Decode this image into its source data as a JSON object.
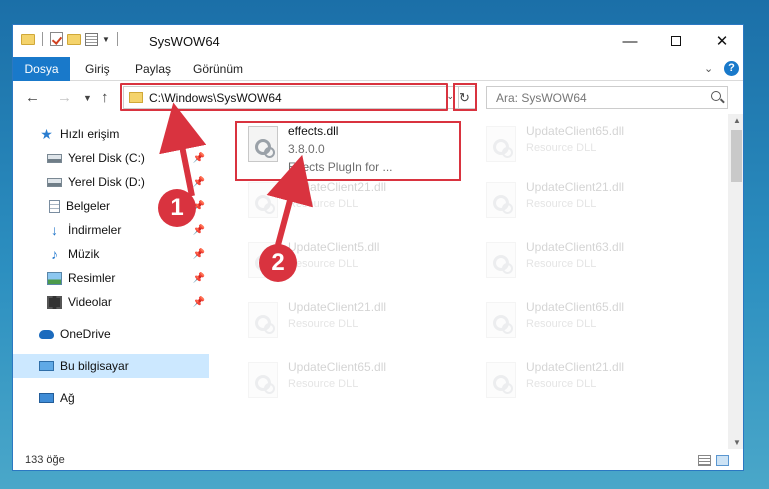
{
  "window": {
    "title": "SysWOW64",
    "minimize_label": "—",
    "maximize_label": "",
    "close_label": "✕"
  },
  "ribbon": {
    "tabs": [
      "Dosya",
      "Giriş",
      "Paylaş",
      "Görünüm"
    ],
    "expand_icon": "chevron-down-icon",
    "help_label": "?"
  },
  "address_bar": {
    "path": "C:\\Windows\\SysWOW64",
    "refresh_icon": "refresh-icon"
  },
  "search": {
    "placeholder": "Ara: SysWOW64"
  },
  "sidebar": {
    "items": [
      {
        "label": "Hızlı erişim",
        "icon": "star-icon"
      },
      {
        "label": "Yerel Disk (C:)",
        "icon": "drive-icon",
        "pinned": true
      },
      {
        "label": "Yerel Disk (D:)",
        "icon": "drive-icon",
        "pinned": true
      },
      {
        "label": "Belgeler",
        "icon": "documents-icon",
        "pinned": true
      },
      {
        "label": "İndirmeler",
        "icon": "downloads-icon",
        "pinned": true
      },
      {
        "label": "Müzik",
        "icon": "music-icon",
        "pinned": true
      },
      {
        "label": "Resimler",
        "icon": "pictures-icon",
        "pinned": true
      },
      {
        "label": "Videolar",
        "icon": "videos-icon",
        "pinned": true
      },
      {
        "label": "OneDrive",
        "icon": "onedrive-icon"
      },
      {
        "label": "Bu bilgisayar",
        "icon": "computer-icon",
        "selected": true
      },
      {
        "label": "Ağ",
        "icon": "network-icon"
      }
    ]
  },
  "files": {
    "highlighted": {
      "name": "effects.dll",
      "version": "3.8.0.0",
      "description": "Effects PlugIn for ..."
    },
    "faded": [
      {
        "name": "UpdateClient65.dll",
        "type": "Resource DLL"
      },
      {
        "name": "UpdateClient21.dll",
        "type": "Resource DLL"
      },
      {
        "name": "UpdateClient21.dll",
        "type": "Resource DLL"
      },
      {
        "name": "UpdateClient5.dll",
        "type": "Resource DLL"
      },
      {
        "name": "UpdateClient63.dll",
        "type": "Resource DLL"
      },
      {
        "name": "UpdateClient65.dll",
        "type": "Resource DLL"
      },
      {
        "name": "UpdateClient21.dll",
        "type": "Resource DLL"
      },
      {
        "name": "UpdateClient65.dll",
        "type": "Resource DLL"
      },
      {
        "name": "UpdateClient65.dll",
        "type": "Resource DLL"
      },
      {
        "name": "UpdateClient21.dll",
        "type": "Resource DLL"
      }
    ]
  },
  "status": {
    "item_count": "133 öğe"
  },
  "callouts": [
    "1",
    "2"
  ],
  "colors": {
    "accent": "#1979ca",
    "highlight": "#d9333f",
    "selected_nav": "#cce8ff"
  }
}
